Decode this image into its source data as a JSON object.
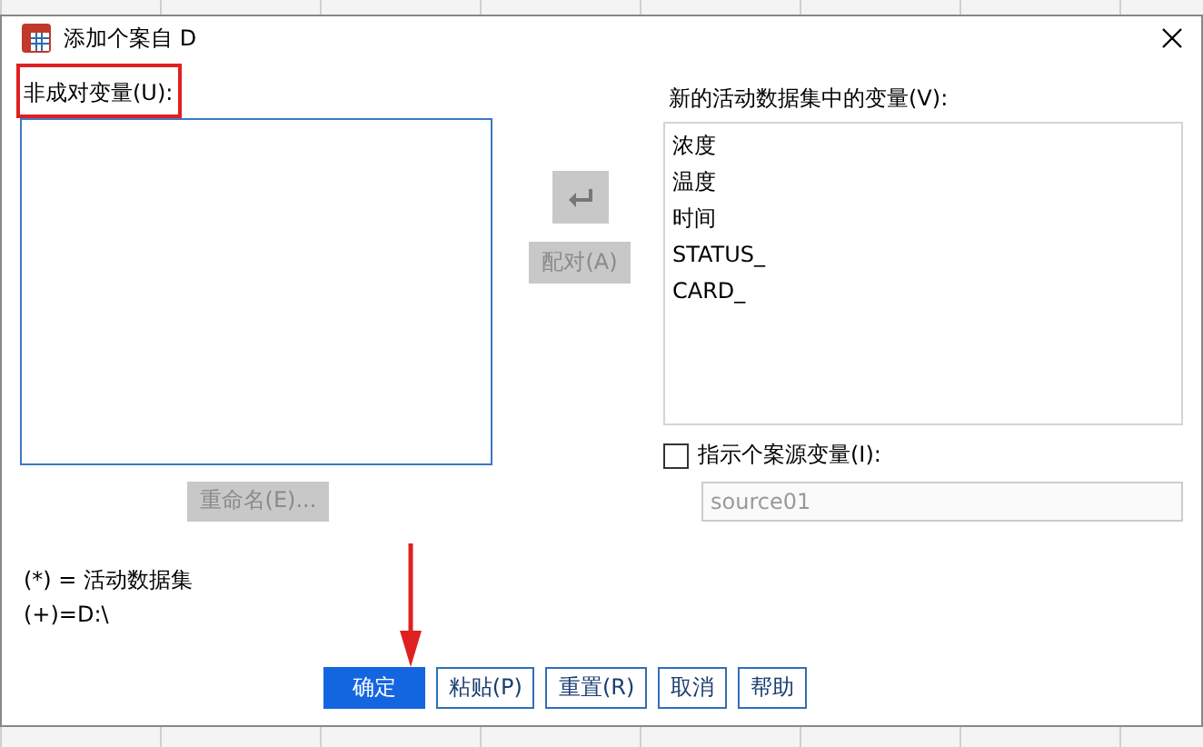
{
  "window": {
    "title": "添加个案自 D"
  },
  "unpaired": {
    "label": "非成对变量(U):"
  },
  "pair_button": {
    "label": "配对(A)",
    "disabled": true
  },
  "rename_button": {
    "label": "重命名(E)...",
    "disabled": true
  },
  "new_vars": {
    "label": "新的活动数据集中的变量(V):",
    "items": [
      "浓度",
      "温度",
      "时间",
      "STATUS_",
      "CARD_"
    ]
  },
  "indicate": {
    "label": "指示个案源变量(I):",
    "checked": false
  },
  "source_field": {
    "value": "source01",
    "disabled": true
  },
  "notes": [
    "(*) = 活动数据集",
    "(+)=D:\\"
  ],
  "buttons": [
    {
      "label": "确定",
      "primary": true
    },
    {
      "label": "粘贴(P)",
      "primary": false
    },
    {
      "label": "重置(R)",
      "primary": false
    },
    {
      "label": "取消",
      "primary": false
    },
    {
      "label": "帮助",
      "primary": false
    }
  ]
}
